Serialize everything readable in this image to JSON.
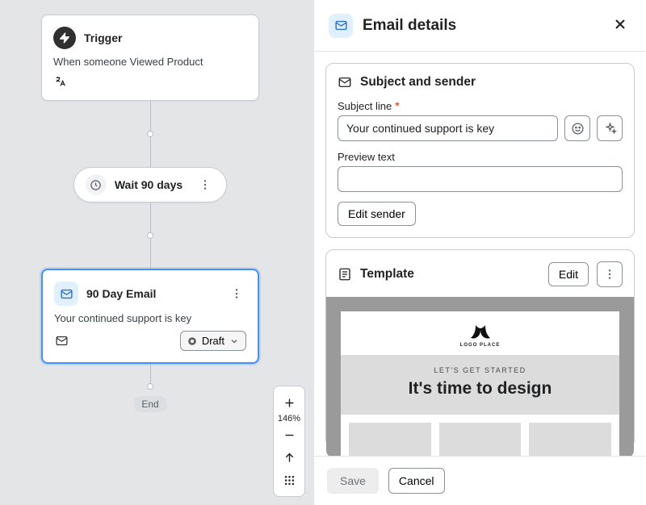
{
  "flow": {
    "trigger": {
      "title": "Trigger",
      "description": "When someone Viewed Product"
    },
    "wait": {
      "title": "Wait 90 days"
    },
    "email_node": {
      "title": "90 Day Email",
      "subtitle": "Your continued support is key",
      "status_label": "Draft"
    },
    "end_label": "End",
    "zoom_level": "146%"
  },
  "panel": {
    "title": "Email details",
    "subject_section": {
      "heading": "Subject and sender",
      "subject_label": "Subject line",
      "subject_value": "Your continued support is key",
      "preview_label": "Preview text",
      "preview_value": "",
      "edit_sender_label": "Edit sender"
    },
    "template_section": {
      "heading": "Template",
      "edit_label": "Edit",
      "preview": {
        "logo_text": "LOGO PLACE",
        "kicker": "LET'S GET STARTED",
        "headline": "It's time to design"
      }
    },
    "footer": {
      "save_label": "Save",
      "cancel_label": "Cancel"
    }
  }
}
